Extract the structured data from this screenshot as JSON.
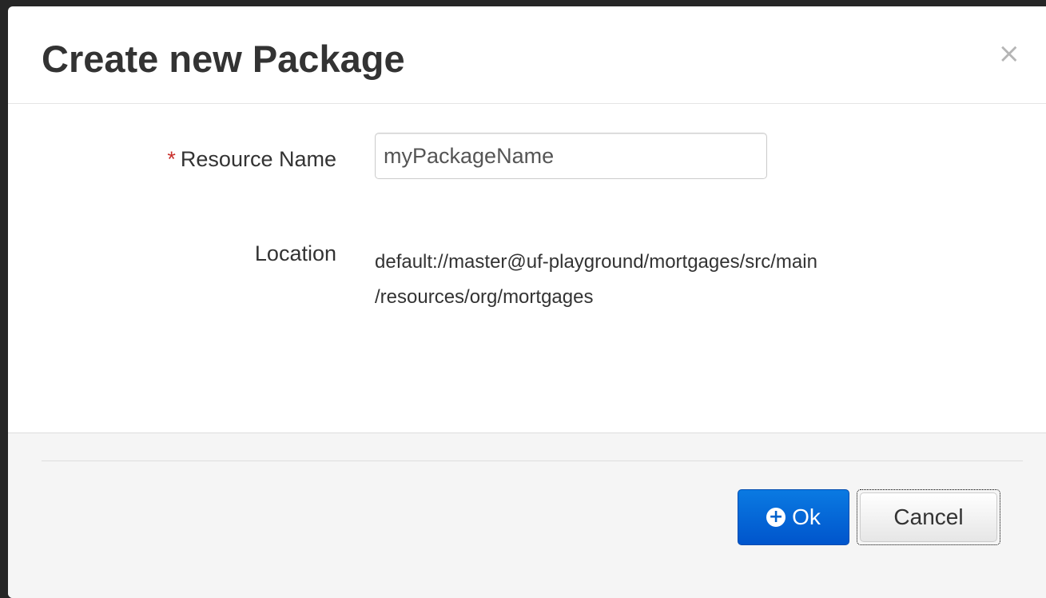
{
  "dialog": {
    "title": "Create new Package",
    "close_glyph": "×"
  },
  "form": {
    "name_field": {
      "required_mark": "*",
      "label": "Resource Name",
      "value": "myPackageName"
    },
    "location": {
      "label": "Location",
      "line1": "default://master@uf-playground/mortgages/src/main",
      "line2": "/resources/org/mortgages"
    }
  },
  "footer": {
    "ok_label": "Ok",
    "ok_icon": "plus-circle-icon",
    "cancel_label": "Cancel"
  },
  "colors": {
    "primary": "#0062cc",
    "required": "#c9302c",
    "footer_bg": "#f5f5f5"
  }
}
